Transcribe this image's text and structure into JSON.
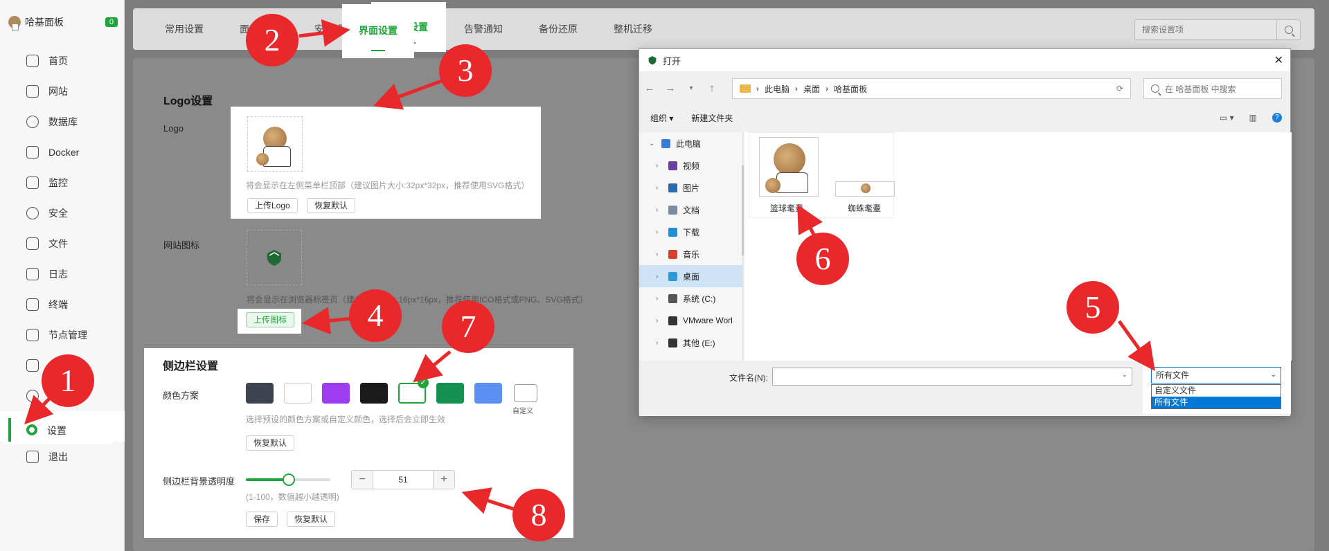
{
  "sidebar": {
    "brand": "哈基面板",
    "badge": "0",
    "items": [
      {
        "label": "首页",
        "icon": "home-icon"
      },
      {
        "label": "网站",
        "icon": "website-icon"
      },
      {
        "label": "数据库",
        "icon": "database-icon"
      },
      {
        "label": "Docker",
        "icon": "docker-icon"
      },
      {
        "label": "监控",
        "icon": "monitor-icon"
      },
      {
        "label": "安全",
        "icon": "shield-icon"
      },
      {
        "label": "文件",
        "icon": "folder-icon"
      },
      {
        "label": "日志",
        "icon": "log-icon"
      },
      {
        "label": "终端",
        "icon": "terminal-icon"
      },
      {
        "label": "节点管理",
        "icon": "node-icon"
      },
      {
        "label": "",
        "icon": "calendar-icon"
      },
      {
        "label": "",
        "icon": "apps-icon"
      },
      {
        "label": "设置",
        "icon": "settings-icon",
        "active": true
      },
      {
        "label": "退出",
        "icon": "logout-icon"
      }
    ]
  },
  "tabs": [
    "常用设置",
    "面板设置",
    "安全设置",
    "界面设置",
    "告警通知",
    "备份还原",
    "整机迁移"
  ],
  "active_tab": "界面设置",
  "search": {
    "placeholder": "搜索设置项"
  },
  "logo_section": {
    "title": "Logo设置",
    "logo_label": "Logo",
    "logo_hint": "将会显示在左侧菜单栏顶部（建议图片大小:32px*32px，推荐使用SVG格式）",
    "upload_logo": "上传Logo",
    "reset": "恢复默认",
    "favicon_label": "网站图标",
    "favicon_hint": "将会显示在浏览器标签页（建议图片大小:16px*16px，推荐使用ICO格式或PNG、SVG格式）",
    "upload_favicon": "上传图标"
  },
  "sidebar_section": {
    "title": "侧边栏设置",
    "color_label": "颜色方案",
    "swatches": [
      "#3d4450",
      "#ffffff",
      "#9d3cf0",
      "#1a1a1a",
      "#ffffff",
      "#149050",
      "#5b8ff2",
      "#ffffff"
    ],
    "custom_label": "自定义",
    "color_hint": "选择预设的颜色方案或自定义颜色，选择后会立即生效",
    "reset": "恢复默认",
    "opacity_label": "侧边栏背景透明度",
    "opacity_value": "51",
    "opacity_fraction": 0.51,
    "opacity_hint": "(1-100，数值越小越透明)",
    "save": "保存",
    "reset2": "恢复默认"
  },
  "dialog": {
    "title": "打开",
    "path": [
      "此电脑",
      "桌面",
      "哈基面板"
    ],
    "search_placeholder": "在 哈基面板 中搜索",
    "organize": "组织 ▾",
    "new_folder": "新建文件夹",
    "tree": [
      {
        "label": "此电脑",
        "color": "#3a7bd5",
        "expanded": true
      },
      {
        "label": "视频",
        "color": "#6b3fa0"
      },
      {
        "label": "图片",
        "color": "#2a6ab0"
      },
      {
        "label": "文档",
        "color": "#7a8aa0"
      },
      {
        "label": "下载",
        "color": "#1e8fd8"
      },
      {
        "label": "音乐",
        "color": "#d8402a"
      },
      {
        "label": "桌面",
        "color": "#2a9ad8",
        "selected": true
      },
      {
        "label": "系统 (C:)",
        "color": "#555555"
      },
      {
        "label": "VMware Worl",
        "color": "#333333"
      },
      {
        "label": "其他 (E:)",
        "color": "#333333"
      }
    ],
    "files": [
      "篮球耄耋",
      "蜘蛛耄耋"
    ],
    "filename_label": "文件名(N):",
    "filter_selected": "所有文件",
    "filter_options": [
      "自定义文件",
      "所有文件"
    ]
  },
  "markers": [
    "1",
    "2",
    "3",
    "4",
    "5",
    "6",
    "7",
    "8"
  ],
  "colors": {
    "accent": "#20a53a",
    "marker": "#e8282a"
  }
}
